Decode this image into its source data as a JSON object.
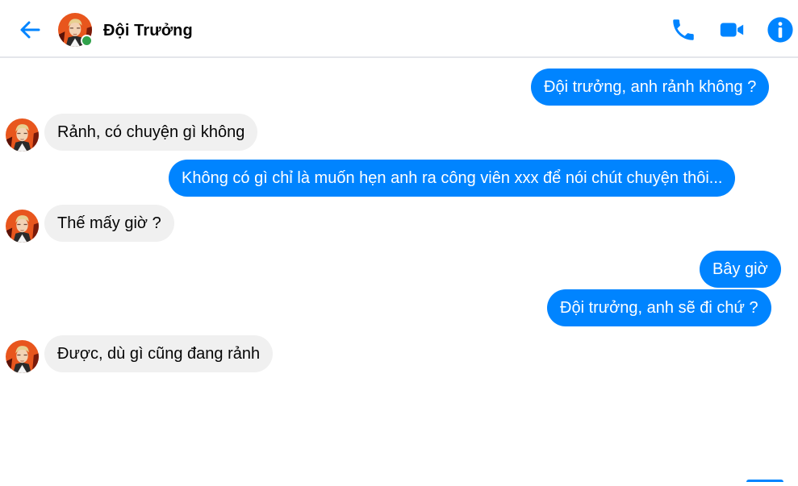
{
  "header": {
    "contact_name": "Đội Trưởng",
    "online": true,
    "icons": [
      "back-arrow-icon",
      "phone-icon",
      "video-camera-icon",
      "info-icon"
    ]
  },
  "colors": {
    "accent": "#0084ff",
    "received_bubble": "#f0f0f0",
    "online": "#31a24c"
  },
  "messages": [
    {
      "sender": "me",
      "text": "Đội trưởng, anh rảnh không ?"
    },
    {
      "sender": "them",
      "text": "Rảnh, có chuyện gì không"
    },
    {
      "sender": "me",
      "text": "Không có gì chỉ là muốn hẹn anh ra công viên xxx để nói chút chuyện thôi..."
    },
    {
      "sender": "them",
      "text": "Thế mấy giờ ?"
    },
    {
      "sender": "me",
      "text": "Bây giờ"
    },
    {
      "sender": "me",
      "text": "Đội trưởng, anh sẽ đi chứ ?"
    },
    {
      "sender": "them",
      "text": "Được, dù gì cũng đang rảnh"
    }
  ]
}
